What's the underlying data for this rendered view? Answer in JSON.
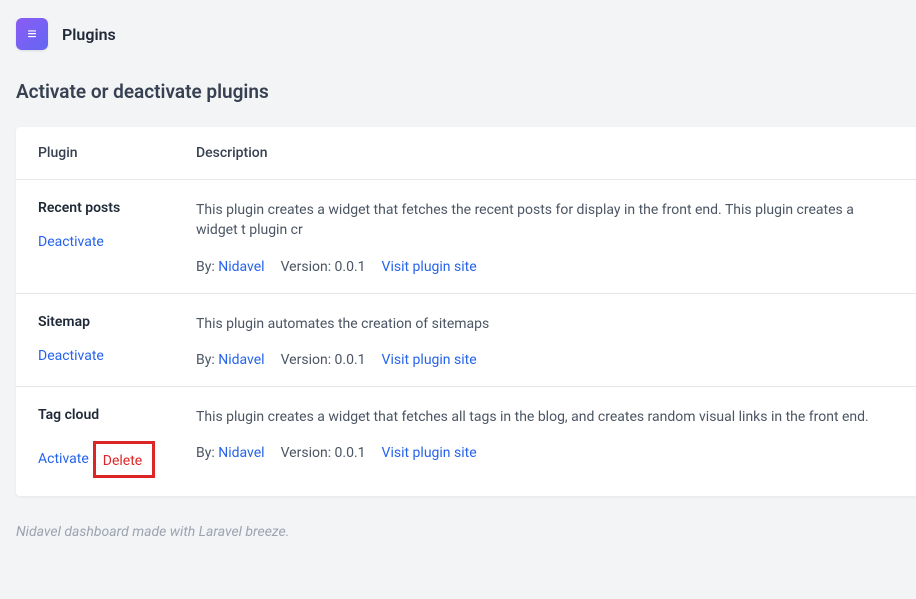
{
  "header": {
    "title": "Plugins"
  },
  "page_title": "Activate or deactivate plugins",
  "table": {
    "columns": {
      "plugin": "Plugin",
      "description": "Description"
    },
    "rows": [
      {
        "name": "Recent posts",
        "actions": [
          {
            "label": "Deactivate",
            "kind": "deactivate"
          }
        ],
        "description": "This plugin creates a widget that fetches the recent posts for display in the front end. This plugin creates a widget t plugin cr",
        "by_label": "By:",
        "author": "Nidavel",
        "version_label": "Version: 0.0.1",
        "visit_label": "Visit plugin site"
      },
      {
        "name": "Sitemap",
        "actions": [
          {
            "label": "Deactivate",
            "kind": "deactivate"
          }
        ],
        "description": "This plugin automates the creation of sitemaps",
        "by_label": "By:",
        "author": "Nidavel",
        "version_label": "Version: 0.0.1",
        "visit_label": "Visit plugin site"
      },
      {
        "name": "Tag cloud",
        "actions": [
          {
            "label": "Activate",
            "kind": "activate"
          },
          {
            "label": "Delete",
            "kind": "delete",
            "highlighted": true
          }
        ],
        "description": "This plugin creates a widget that fetches all tags in the blog, and creates random visual links in the front end.",
        "by_label": "By:",
        "author": "Nidavel",
        "version_label": "Version: 0.0.1",
        "visit_label": "Visit plugin site"
      }
    ]
  },
  "footer": "Nidavel dashboard made with Laravel breeze."
}
